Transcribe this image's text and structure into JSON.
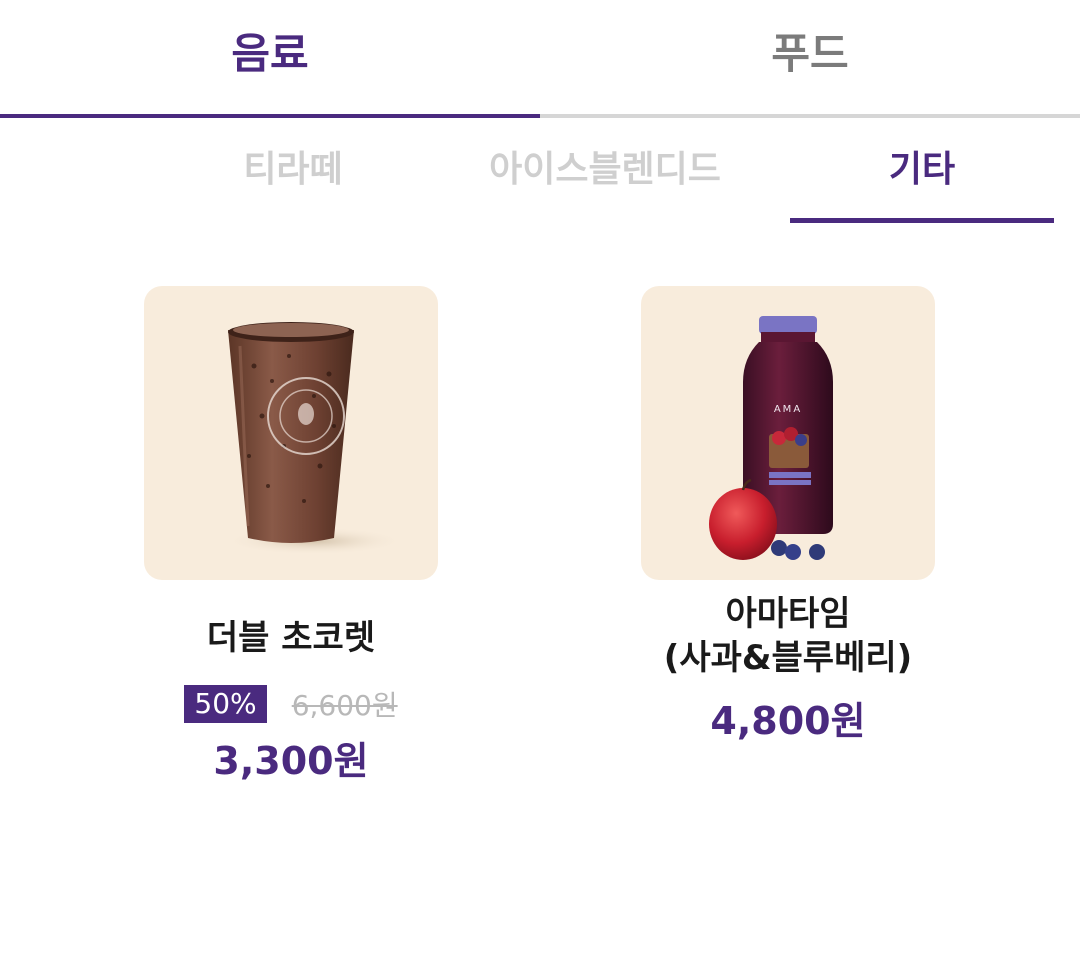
{
  "primary_tabs": {
    "drink": "음료",
    "food": "푸드"
  },
  "sub_tabs": {
    "tiralatte": "티라떼",
    "iceblended": "아이스블렌디드",
    "etc": "기타"
  },
  "active_primary_tab": "음료",
  "active_sub_tab": "기타",
  "products": [
    {
      "name": "더블 초코렛",
      "badge": "50%",
      "original_price": "6,600원",
      "price": "3,300원",
      "image_icon": "iced-chocolate-cup-image"
    },
    {
      "name_line1": "아마타임",
      "name_line2": "(사과&블루베리)",
      "price": "4,800원",
      "image_icon": "juice-bottle-apple-image"
    }
  ],
  "colors": {
    "accent": "#4a2a7f",
    "inactive_tab_text": "#7b7b7b",
    "inactive_sub_tab_text": "#cfcfcf",
    "thumb_background": "#f8ecdc",
    "strikethrough_text": "#b8b8b8"
  }
}
